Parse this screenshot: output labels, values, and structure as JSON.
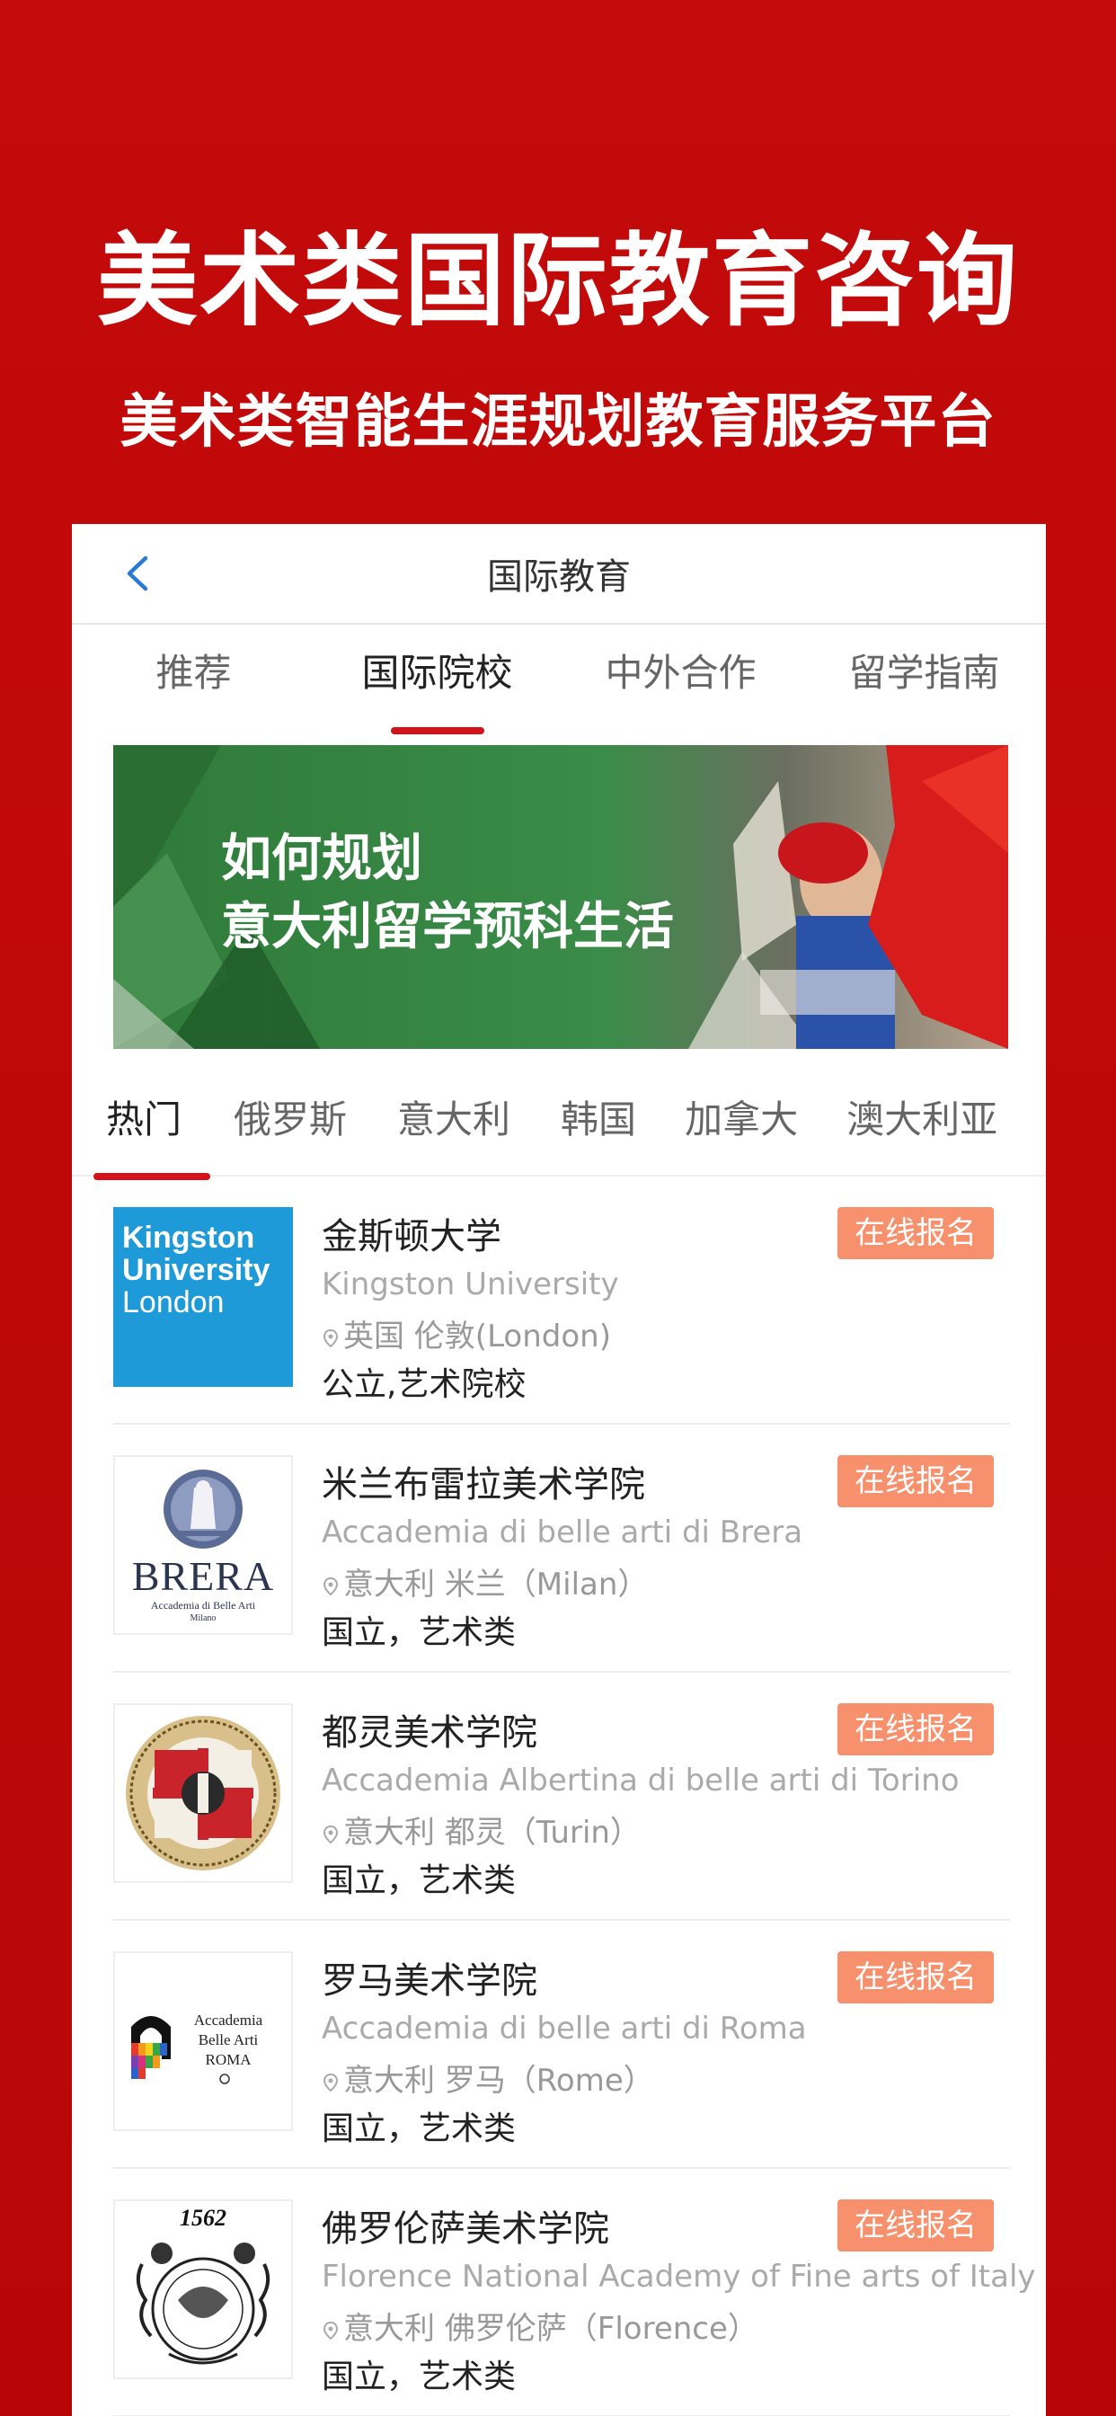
{
  "promo": {
    "title": "美术类国际教育咨询",
    "subtitle": "美术类智能生涯规划教育服务平台"
  },
  "navbar": {
    "back_icon": "chevron-left-icon",
    "title": "国际教育"
  },
  "tabs": [
    {
      "label": "推荐",
      "active": false
    },
    {
      "label": "国际院校",
      "active": true
    },
    {
      "label": "中外合作",
      "active": false
    },
    {
      "label": "留学指南",
      "active": false
    }
  ],
  "banner": {
    "line1": "如何规划",
    "line2": "意大利留学预科生活"
  },
  "country_tabs": [
    {
      "label": "热门",
      "active": true
    },
    {
      "label": "俄罗斯",
      "active": false
    },
    {
      "label": "意大利",
      "active": false
    },
    {
      "label": "韩国",
      "active": false
    },
    {
      "label": "加拿大",
      "active": false
    },
    {
      "label": "澳大利亚",
      "active": false
    }
  ],
  "schools": [
    {
      "name": "金斯顿大学",
      "english_name": "Kingston University",
      "location": "英国 伦敦(London)",
      "tags": "公立,艺术院校",
      "enroll_label": "在线报名",
      "logo": {
        "type": "kingston",
        "line1": "Kingston",
        "line2": "University",
        "line3": "London"
      }
    },
    {
      "name": "米兰布雷拉美术学院",
      "english_name": "Accademia di belle arti di Brera",
      "location": "意大利 米兰（Milan）",
      "tags": "国立，艺术类",
      "enroll_label": "在线报名",
      "logo": {
        "type": "brera",
        "line1": "BRERA",
        "line2": "Accademia di Belle Arti",
        "line3": "Milano"
      }
    },
    {
      "name": "都灵美术学院",
      "english_name": "Accademia Albertina di belle arti di Torino",
      "location": "意大利 都灵（Turin）",
      "tags": "国立，艺术类",
      "enroll_label": "在线报名",
      "logo": {
        "type": "torino-seal"
      }
    },
    {
      "name": "罗马美术学院",
      "english_name": "Accademia di belle arti di Roma",
      "location": "意大利 罗马（Rome）",
      "tags": "国立，艺术类",
      "enroll_label": "在线报名",
      "logo": {
        "type": "roma",
        "line1": "Accademia",
        "line2": "Belle Arti",
        "line3": "ROMA"
      }
    },
    {
      "name": "佛罗伦萨美术学院",
      "english_name": "Florence National Academy of Fine arts of Italy",
      "location": "意大利 佛罗伦萨（Florence）",
      "tags": "国立，艺术类",
      "enroll_label": "在线报名",
      "logo": {
        "type": "firenze",
        "line1": "1562"
      }
    }
  ],
  "colors": {
    "background_red": "#c40a0a",
    "accent_red": "#d4121a",
    "enroll_button": "#f7916d",
    "kingston_blue": "#1f9ad9"
  }
}
